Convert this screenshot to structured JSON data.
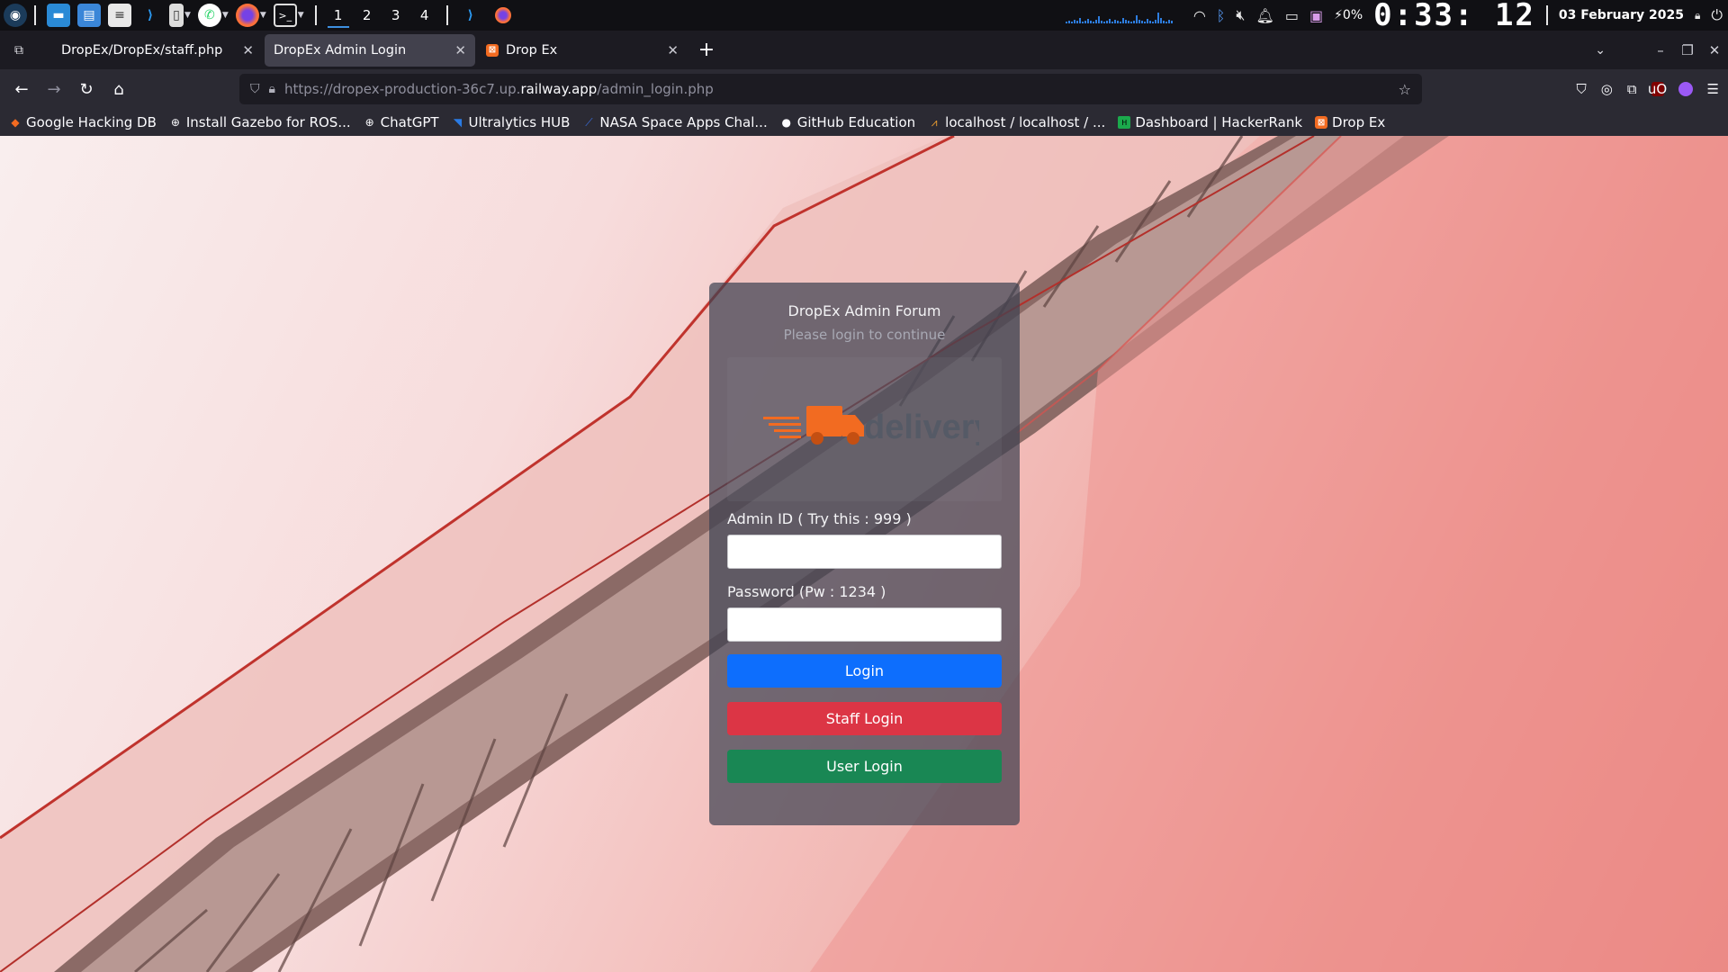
{
  "taskbar": {
    "workspaces": [
      "1",
      "2",
      "3",
      "4"
    ],
    "battery": "0%",
    "clock": "0:33: 12",
    "date": "03 February 2025"
  },
  "tabs": [
    {
      "title": "DropEx/DropEx/staff.php",
      "active": false
    },
    {
      "title": "DropEx Admin Login",
      "active": true
    },
    {
      "title": "Drop Ex",
      "active": false
    }
  ],
  "url": {
    "prefix": "https://dropex-production-36c7.up.",
    "host": "railway.app",
    "path": "/admin_login.php"
  },
  "bookmarks": [
    {
      "label": "Google Hacking DB",
      "icon": "flame-icon"
    },
    {
      "label": "Install Gazebo for ROS...",
      "icon": "globe-icon"
    },
    {
      "label": "ChatGPT",
      "icon": "globe-icon"
    },
    {
      "label": "Ultralytics HUB",
      "icon": "ultralytics-icon"
    },
    {
      "label": "NASA Space Apps Chal...",
      "icon": "nasa-icon"
    },
    {
      "label": "GitHub Education",
      "icon": "github-icon"
    },
    {
      "label": "localhost / localhost / ...",
      "icon": "phpmyadmin-icon"
    },
    {
      "label": "Dashboard | HackerRank",
      "icon": "hackerrank-icon"
    },
    {
      "label": "Drop Ex",
      "icon": "dropex-icon"
    }
  ],
  "login": {
    "title": "DropEx Admin Forum",
    "subtitle": "Please login to continue",
    "logo_text": "delivery",
    "admin_id_label": "Admin ID ( Try this : 999 )",
    "admin_id_value": "",
    "password_label": "Password (Pw : 1234 )",
    "password_value": "",
    "login_button": "Login",
    "staff_button": "Staff Login",
    "user_button": "User Login"
  },
  "colors": {
    "login_button": "#0d6efd",
    "staff_button": "#dc3545",
    "user_button": "#198754",
    "logo_orange": "#f26b21"
  }
}
